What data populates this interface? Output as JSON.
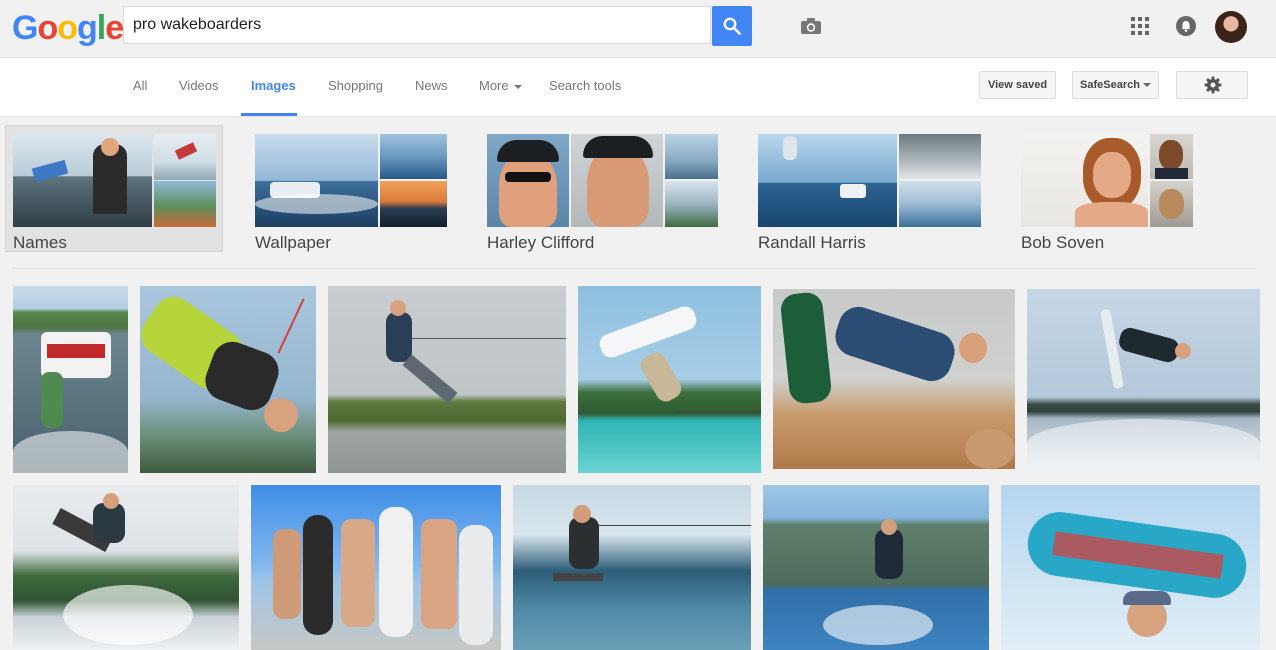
{
  "header": {
    "logo": [
      "G",
      "o",
      "o",
      "g",
      "l",
      "e"
    ],
    "logo_colors": [
      "#4285f4",
      "#ea4335",
      "#fbbc05",
      "#4285f4",
      "#34a853",
      "#ea4335"
    ],
    "search_query": "pro wakeboarders",
    "accent": "#4285f4"
  },
  "nav": {
    "tabs": [
      "All",
      "Videos",
      "Images",
      "Shopping",
      "News",
      "More",
      "Search tools"
    ],
    "active_tab": "Images",
    "view_saved": "View saved",
    "safesearch": "SafeSearch"
  },
  "related": [
    {
      "label": "Names"
    },
    {
      "label": "Wallpaper"
    },
    {
      "label": "Harley Clifford"
    },
    {
      "label": "Randall Harris"
    },
    {
      "label": "Bob Soven"
    }
  ],
  "results_count_row1": 6,
  "icons": {
    "camera": "camera-icon",
    "search": "search-icon",
    "apps": "apps-grid-icon",
    "notifications": "notifications-icon",
    "settings": "gear-icon"
  }
}
